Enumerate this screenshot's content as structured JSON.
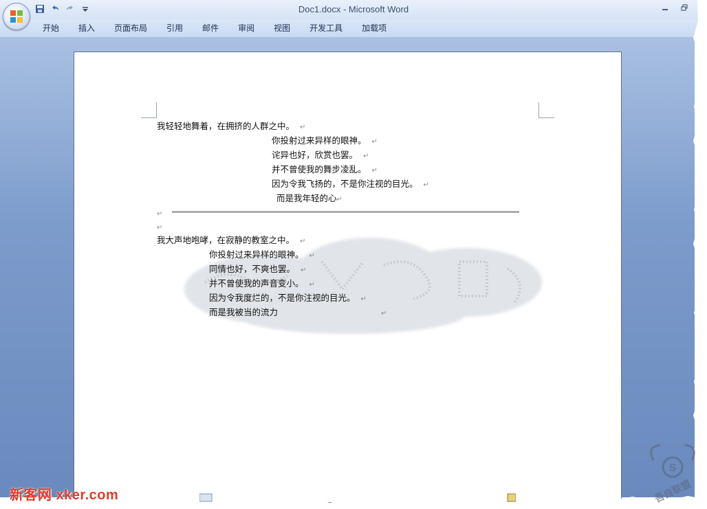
{
  "window": {
    "title": "Doc1.docx - Microsoft Word"
  },
  "quick_access": {
    "items": [
      "save-icon",
      "undo-icon",
      "redo-icon",
      "customize-icon"
    ]
  },
  "ribbon": {
    "tabs": [
      "开始",
      "插入",
      "页面布局",
      "引用",
      "邮件",
      "审阅",
      "视图",
      "开发工具",
      "加载项"
    ]
  },
  "document": {
    "para_mark": "↵",
    "stanza1": [
      "我轻轻地舞着，在拥挤的人群之中。",
      "你投射过来异样的眼神。",
      "诧异也好，欣赏也罢。",
      "并不曾使我的舞步凌乱。",
      "因为令我飞扬的，不是你注视的目光。",
      "而是我年轻的心"
    ],
    "stanza2": [
      "我大声地咆哮，在寂静的教室之中。",
      "你投射过来异样的眼神。",
      "同情也好，不爽也罢。",
      "并不曾使我的声音变小。",
      "因为令我度烂的，不是你注视的目光。",
      "而是我被当的流力"
    ]
  },
  "watermark": {
    "brand_left": "新客网 xker.com",
    "brand_right": "吾自联盟"
  }
}
